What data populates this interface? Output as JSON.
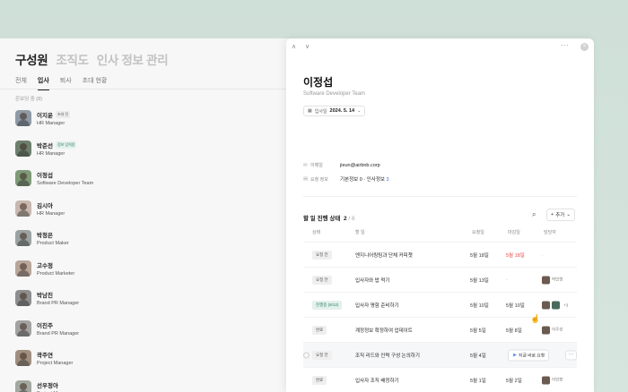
{
  "left": {
    "title": "구성원",
    "title_tabs": [
      "조직도",
      "인사 정보 관리"
    ],
    "tabs": [
      "전체",
      "입사",
      "퇴사",
      "초대 현황"
    ],
    "active_tab_index": 1,
    "section_label": "온보딩 중 (8)",
    "employees": [
      {
        "name": "이지윤",
        "tag": "초대 전",
        "tag_color": "gray",
        "role": "HR Manager",
        "avatar_color": "#8f9aa6"
      },
      {
        "name": "박준선",
        "tag": "정보 입력함",
        "tag_color": "green",
        "role": "HR Manager",
        "avatar_color": "#6d7f6e"
      },
      {
        "name": "이정섭",
        "tag": "",
        "tag_color": "",
        "role": "Software Developer Team",
        "avatar_color": "#7f9a78"
      },
      {
        "name": "김시아",
        "tag": "",
        "tag_color": "",
        "role": "HR Manager",
        "avatar_color": "#c7b8b0"
      },
      {
        "name": "박정은",
        "tag": "",
        "tag_color": "",
        "role": "Product Maker",
        "avatar_color": "#9aa3a1"
      },
      {
        "name": "고수정",
        "tag": "",
        "tag_color": "",
        "role": "Product Marketer",
        "avatar_color": "#b8a69a"
      },
      {
        "name": "박남진",
        "tag": "",
        "tag_color": "",
        "role": "Brand PR Manager",
        "avatar_color": "#8e8e8e"
      },
      {
        "name": "이진주",
        "tag": "",
        "tag_color": "",
        "role": "Brand PR Manager",
        "avatar_color": "#a2a2a2"
      },
      {
        "name": "곽주연",
        "tag": "",
        "tag_color": "",
        "role": "Project Manager",
        "avatar_color": "#9f8f7f"
      },
      {
        "name": "선우정아",
        "tag": "",
        "tag_color": "",
        "role": "Project Manager",
        "avatar_color": "#a3a8a0"
      }
    ]
  },
  "panel": {
    "nav_up": "∧",
    "nav_down": "∨",
    "more": "···",
    "close": "×",
    "name": "이정섭",
    "team": "Software Developer Team",
    "join_label": "입사일",
    "join_date": "2024. 5. 14",
    "join_chevron": "⌄",
    "email_label": "이메일",
    "email_value": "jieun@airbnb.corp",
    "request_label": "요청 정보",
    "request_basic": "기본정보 0",
    "request_sep": " · ",
    "request_hr_prefix": "인사정보 ",
    "request_hr_count": "3",
    "todo_title": "할 일 진행 상태",
    "todo_done": "2",
    "todo_total": " / 6",
    "add_label": "추가",
    "headers": {
      "status": "상태",
      "task": "할 일",
      "due": "요청일",
      "done": "마감일",
      "owner": "담당자"
    },
    "rows": [
      {
        "status": "요청 전",
        "status_color": "gray",
        "task": "엔지니어링팀과 단체 커피챗",
        "due": "5월 18일",
        "done": "5월 18일",
        "done_red": true,
        "owner": "-",
        "owner_extra": ""
      },
      {
        "status": "요청 전",
        "status_color": "gray",
        "task": "입사자와 밥 먹기",
        "due": "5월 13일",
        "done": "-",
        "done_red": false,
        "owner": "박민형",
        "owner_extra": ""
      },
      {
        "status": "진행중 (8/12)",
        "status_color": "green",
        "task": "입사자 명함 준비하기",
        "due": "5월 10일",
        "done": "5월 10일",
        "done_red": false,
        "owner": "",
        "owner_extra": "+3"
      },
      {
        "status": "완료",
        "status_color": "gray",
        "task": "계정정보 확정하여 업데이트",
        "due": "5월 5일",
        "done": "5월 8일",
        "done_red": false,
        "owner": "이주성",
        "owner_extra": ""
      },
      {
        "status": "요청 전",
        "status_color": "gray",
        "task": "조직 리드와 인력 구성 논의하기",
        "due": "5월 4일",
        "done": "",
        "done_red": false,
        "owner": "",
        "owner_extra": ""
      },
      {
        "status": "완료",
        "status_color": "gray",
        "task": "입사자 조직 배정하기",
        "due": "5월 1일",
        "done": "5월 2일",
        "done_red": false,
        "owner": "이민정",
        "owner_extra": ""
      }
    ],
    "request_now": "지금 바로 요청",
    "row_more": "···"
  },
  "colors": {
    "accent_blue": "#3a6ee8",
    "overdue_red": "#e54646",
    "status_green": "#2f7f63"
  }
}
